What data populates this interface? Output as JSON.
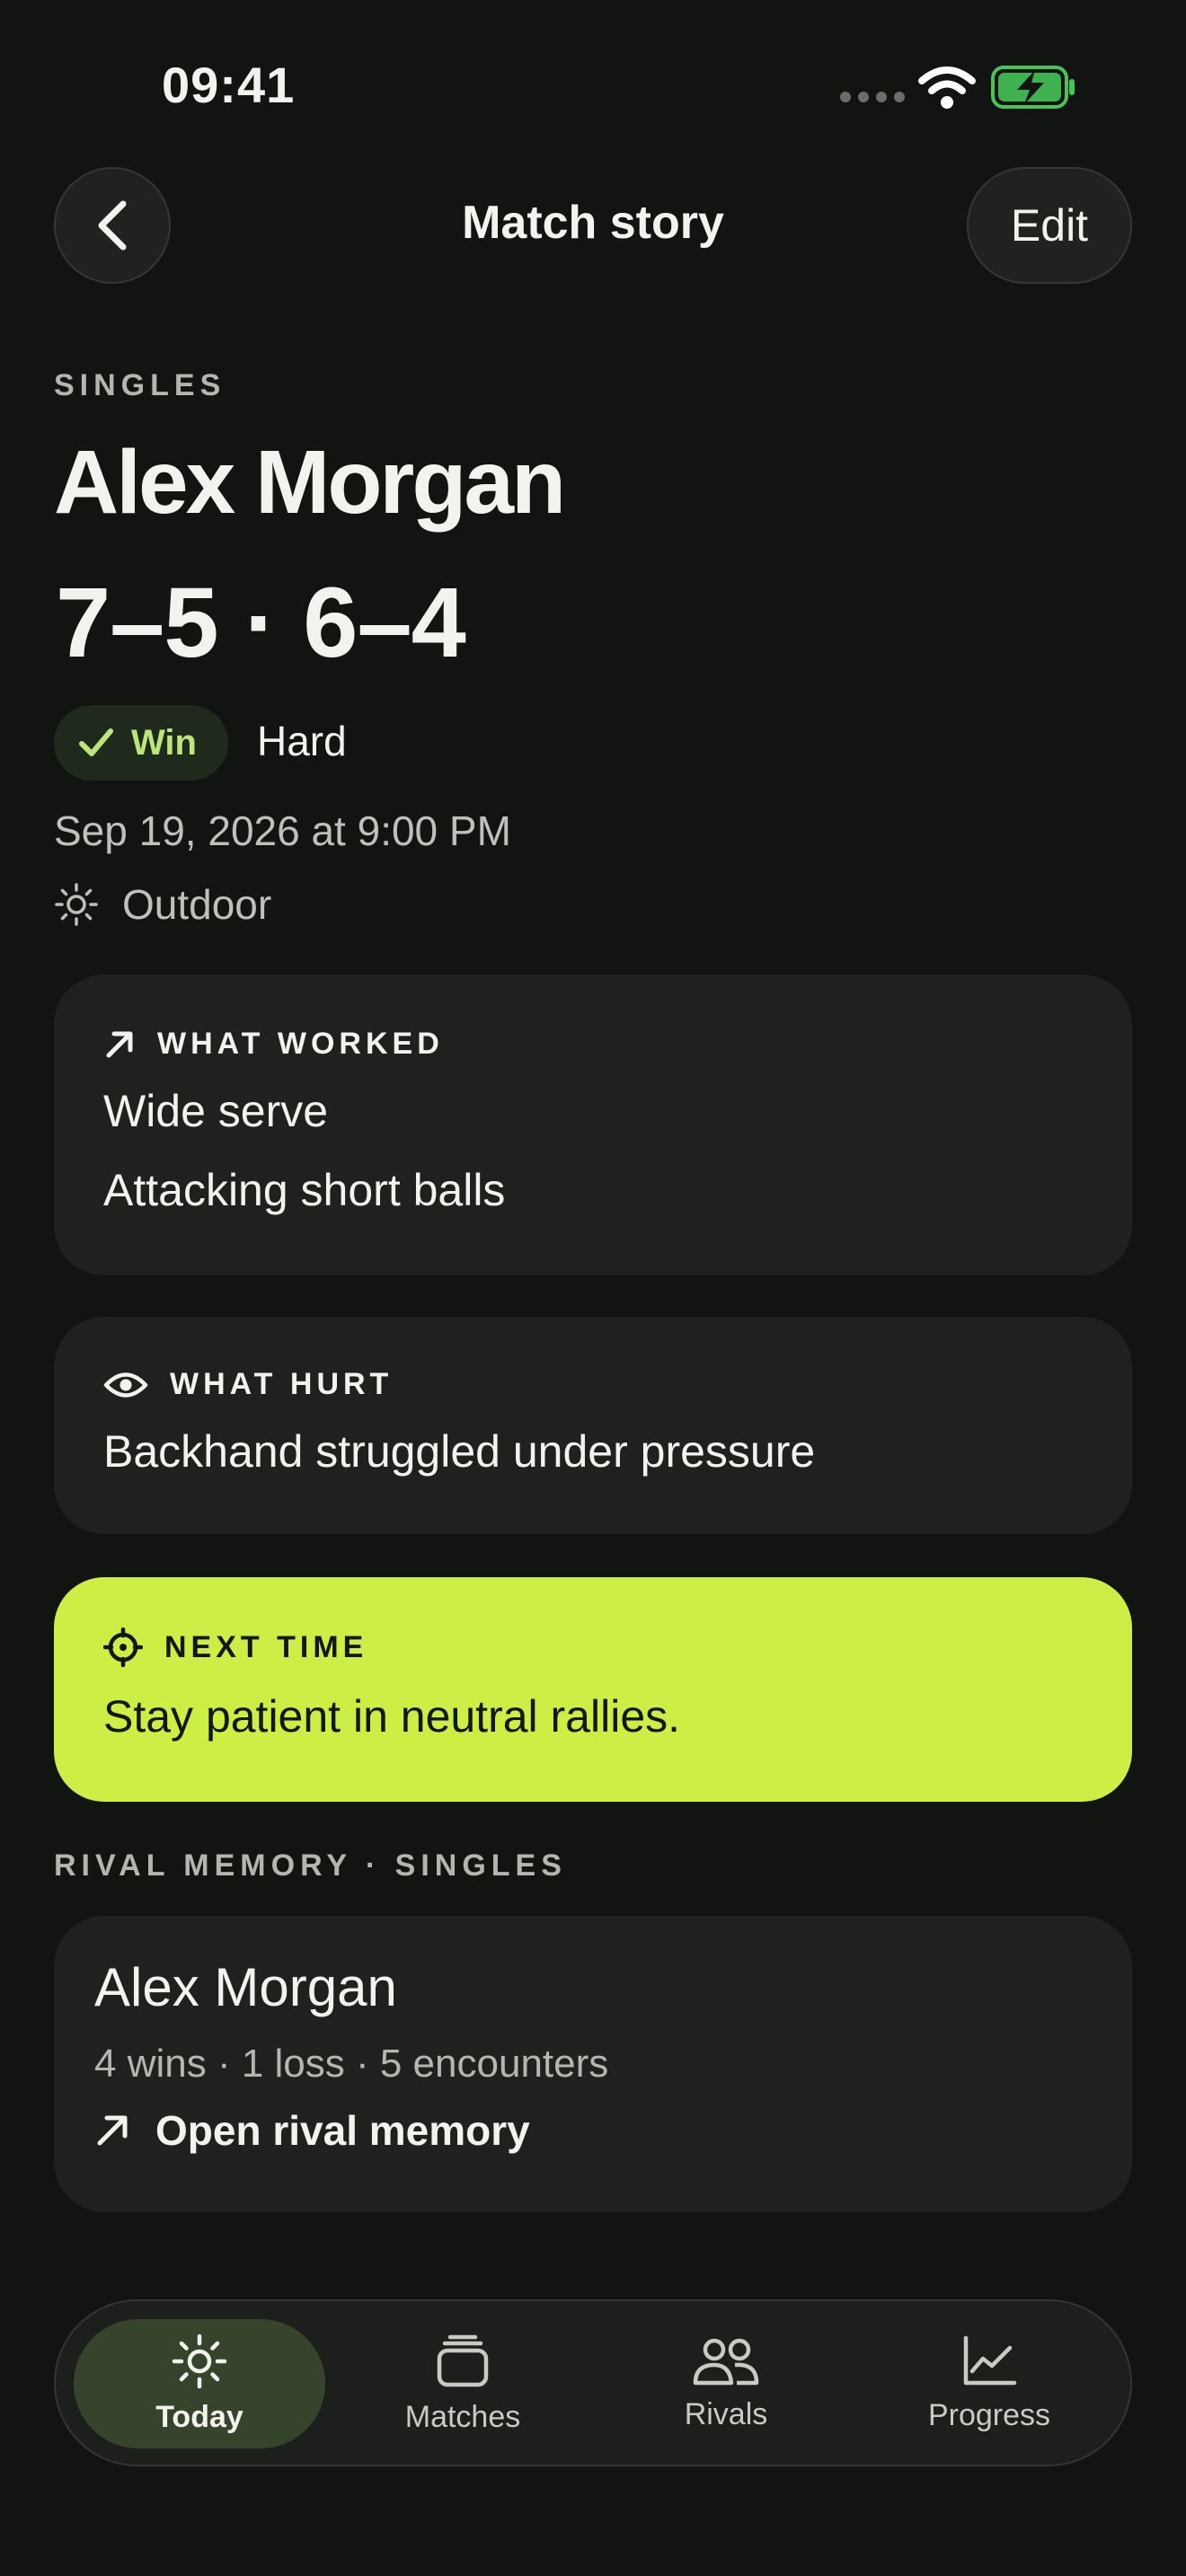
{
  "status_bar": {
    "time": "09:41"
  },
  "header": {
    "title": "Match story",
    "edit_label": "Edit"
  },
  "match": {
    "type_label": "SINGLES",
    "opponent": "Alex Morgan",
    "score": "7–5 · 6–4",
    "result": "Win",
    "surface": "Hard",
    "datetime": "Sep 19, 2026 at 9:00 PM",
    "conditions": "Outdoor"
  },
  "what_worked": {
    "label": "WHAT WORKED",
    "items": [
      "Wide serve",
      "Attacking short balls"
    ]
  },
  "what_hurt": {
    "label": "WHAT HURT",
    "items": [
      "Backhand struggled under pressure"
    ]
  },
  "next_time": {
    "label": "NEXT TIME",
    "text": "Stay patient in neutral rallies."
  },
  "rival_memory": {
    "section_label": "RIVAL MEMORY · SINGLES",
    "name": "Alex Morgan",
    "record": "4 wins · 1 loss · 5 encounters",
    "link_label": "Open rival memory"
  },
  "colors": {
    "background": "#121412",
    "accent": "#cdee44",
    "win": "#bde57b",
    "card": "#1e211e"
  },
  "tabs": [
    {
      "label": "Today",
      "icon": "sun-icon",
      "active": true
    },
    {
      "label": "Matches",
      "icon": "stack-icon",
      "active": false
    },
    {
      "label": "Rivals",
      "icon": "people-icon",
      "active": false
    },
    {
      "label": "Progress",
      "icon": "chart-icon",
      "active": false
    }
  ]
}
